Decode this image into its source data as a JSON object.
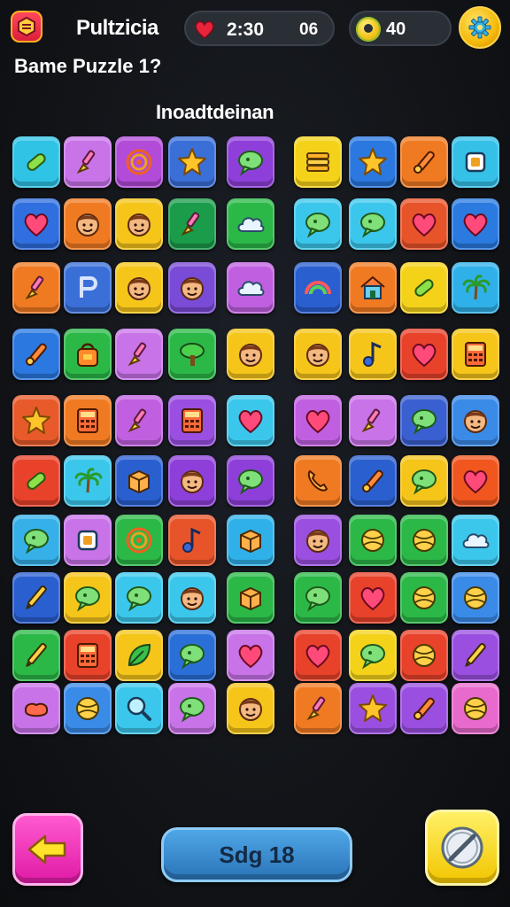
{
  "header": {
    "app_title": "Pultzicia",
    "timer": "2:30",
    "moves": "06",
    "score": "40",
    "logo_icon": "puzzle-logo-icon",
    "timer_icon": "heart-icon",
    "score_icon": "coin-icon",
    "settings_icon": "gear-icon"
  },
  "subtitle": "Bame Puzzle 1?",
  "section_label": "Inoadtdeinan",
  "board": {
    "rows": 10,
    "cols": 9,
    "tiles": [
      [
        "#2fc3e6:pill",
        "#c873e8:brush",
        "#b14bd8:spiral",
        "#3a6fd8:star",
        "#8e3fd9:bubble",
        "#f5d21a:stack",
        "#2a78e0:star",
        "#f07a22:wrench",
        "#35c0e8:square"
      ],
      [
        "#2f6fe0:heart",
        "#f07a22:face",
        "#f5c51a:face",
        "#1a9c4a:brush",
        "#2bb847:cloud",
        "#3bc7ec:bubble",
        "#3bc7ec:bubble",
        "#e8542a:heart",
        "#2a7ae0:heart"
      ],
      [
        "#f07a22:brush",
        "#3a6fd8:letter",
        "#f5c51a:face",
        "#7a4bd6:face",
        "#c060e0:cloud",
        "#2a5fd0:rainbow",
        "#f07a22:house",
        "#f5d21a:pill",
        "#2fb0e8:palm"
      ],
      [
        "#2a78e0:wrench",
        "#2bb847:bag",
        "#c873e8:brush",
        "#2bb847:tree",
        "#f5c51a:face",
        "#f5c51a:face",
        "#f5c51a:note",
        "#e8422a:heart",
        "#f5c51a:calc"
      ],
      [
        "#e85a2a:star",
        "#f07a22:calc",
        "#c060e0:brush",
        "#9a4fe0:calc",
        "#3bc7ec:heart",
        "#c060e0:heart",
        "#c873e8:brush",
        "#3a5fd0:bubble",
        "#3a8ae8:face"
      ],
      [
        "#e8422a:pill",
        "#3bc7ec:palm",
        "#2a5fd0:box",
        "#8e3fd9:face",
        "#8e3fd9:bubble",
        "#f07a22:phone",
        "#2a5fd0:wrench",
        "#f5c51a:bubble",
        "#f0561e:heart"
      ],
      [
        "#35b0e8:bubble",
        "#c873e8:square",
        "#2bb847:spiral",
        "#e8542a:note",
        "#2fb0e8:box",
        "#9a4fe0:face",
        "#2bb847:ball",
        "#2bb847:ball",
        "#3bc7ec:cloud"
      ],
      [
        "#2a5fd0:pen",
        "#f5c51a:bubble",
        "#3bc7ec:bubble",
        "#3bc7ec:face",
        "#2bb847:box",
        "#2bb847:bubble",
        "#e8422a:heart",
        "#2bb847:ball",
        "#3a8ae8:ball"
      ],
      [
        "#2bb847:pen",
        "#e8422a:calc",
        "#f5c51a:leaf",
        "#2a6fd8:bubble",
        "#c873e8:heart",
        "#e8422a:heart",
        "#f5d21a:bubble",
        "#e8422a:ball",
        "#9a4fe0:pen"
      ],
      [
        "#c873e8:blob",
        "#3a8ae8:ball",
        "#3bc7ec:search",
        "#c873e8:bubble",
        "#f5c51a:face",
        "#f07a22:brush",
        "#9a4fe0:star",
        "#9a4fe0:wrench",
        "#e86acc:ball"
      ]
    ]
  },
  "footer": {
    "back_icon": "arrow-left-icon",
    "stage_label": "Sdg 18",
    "hint_icon": "compass-icon"
  }
}
